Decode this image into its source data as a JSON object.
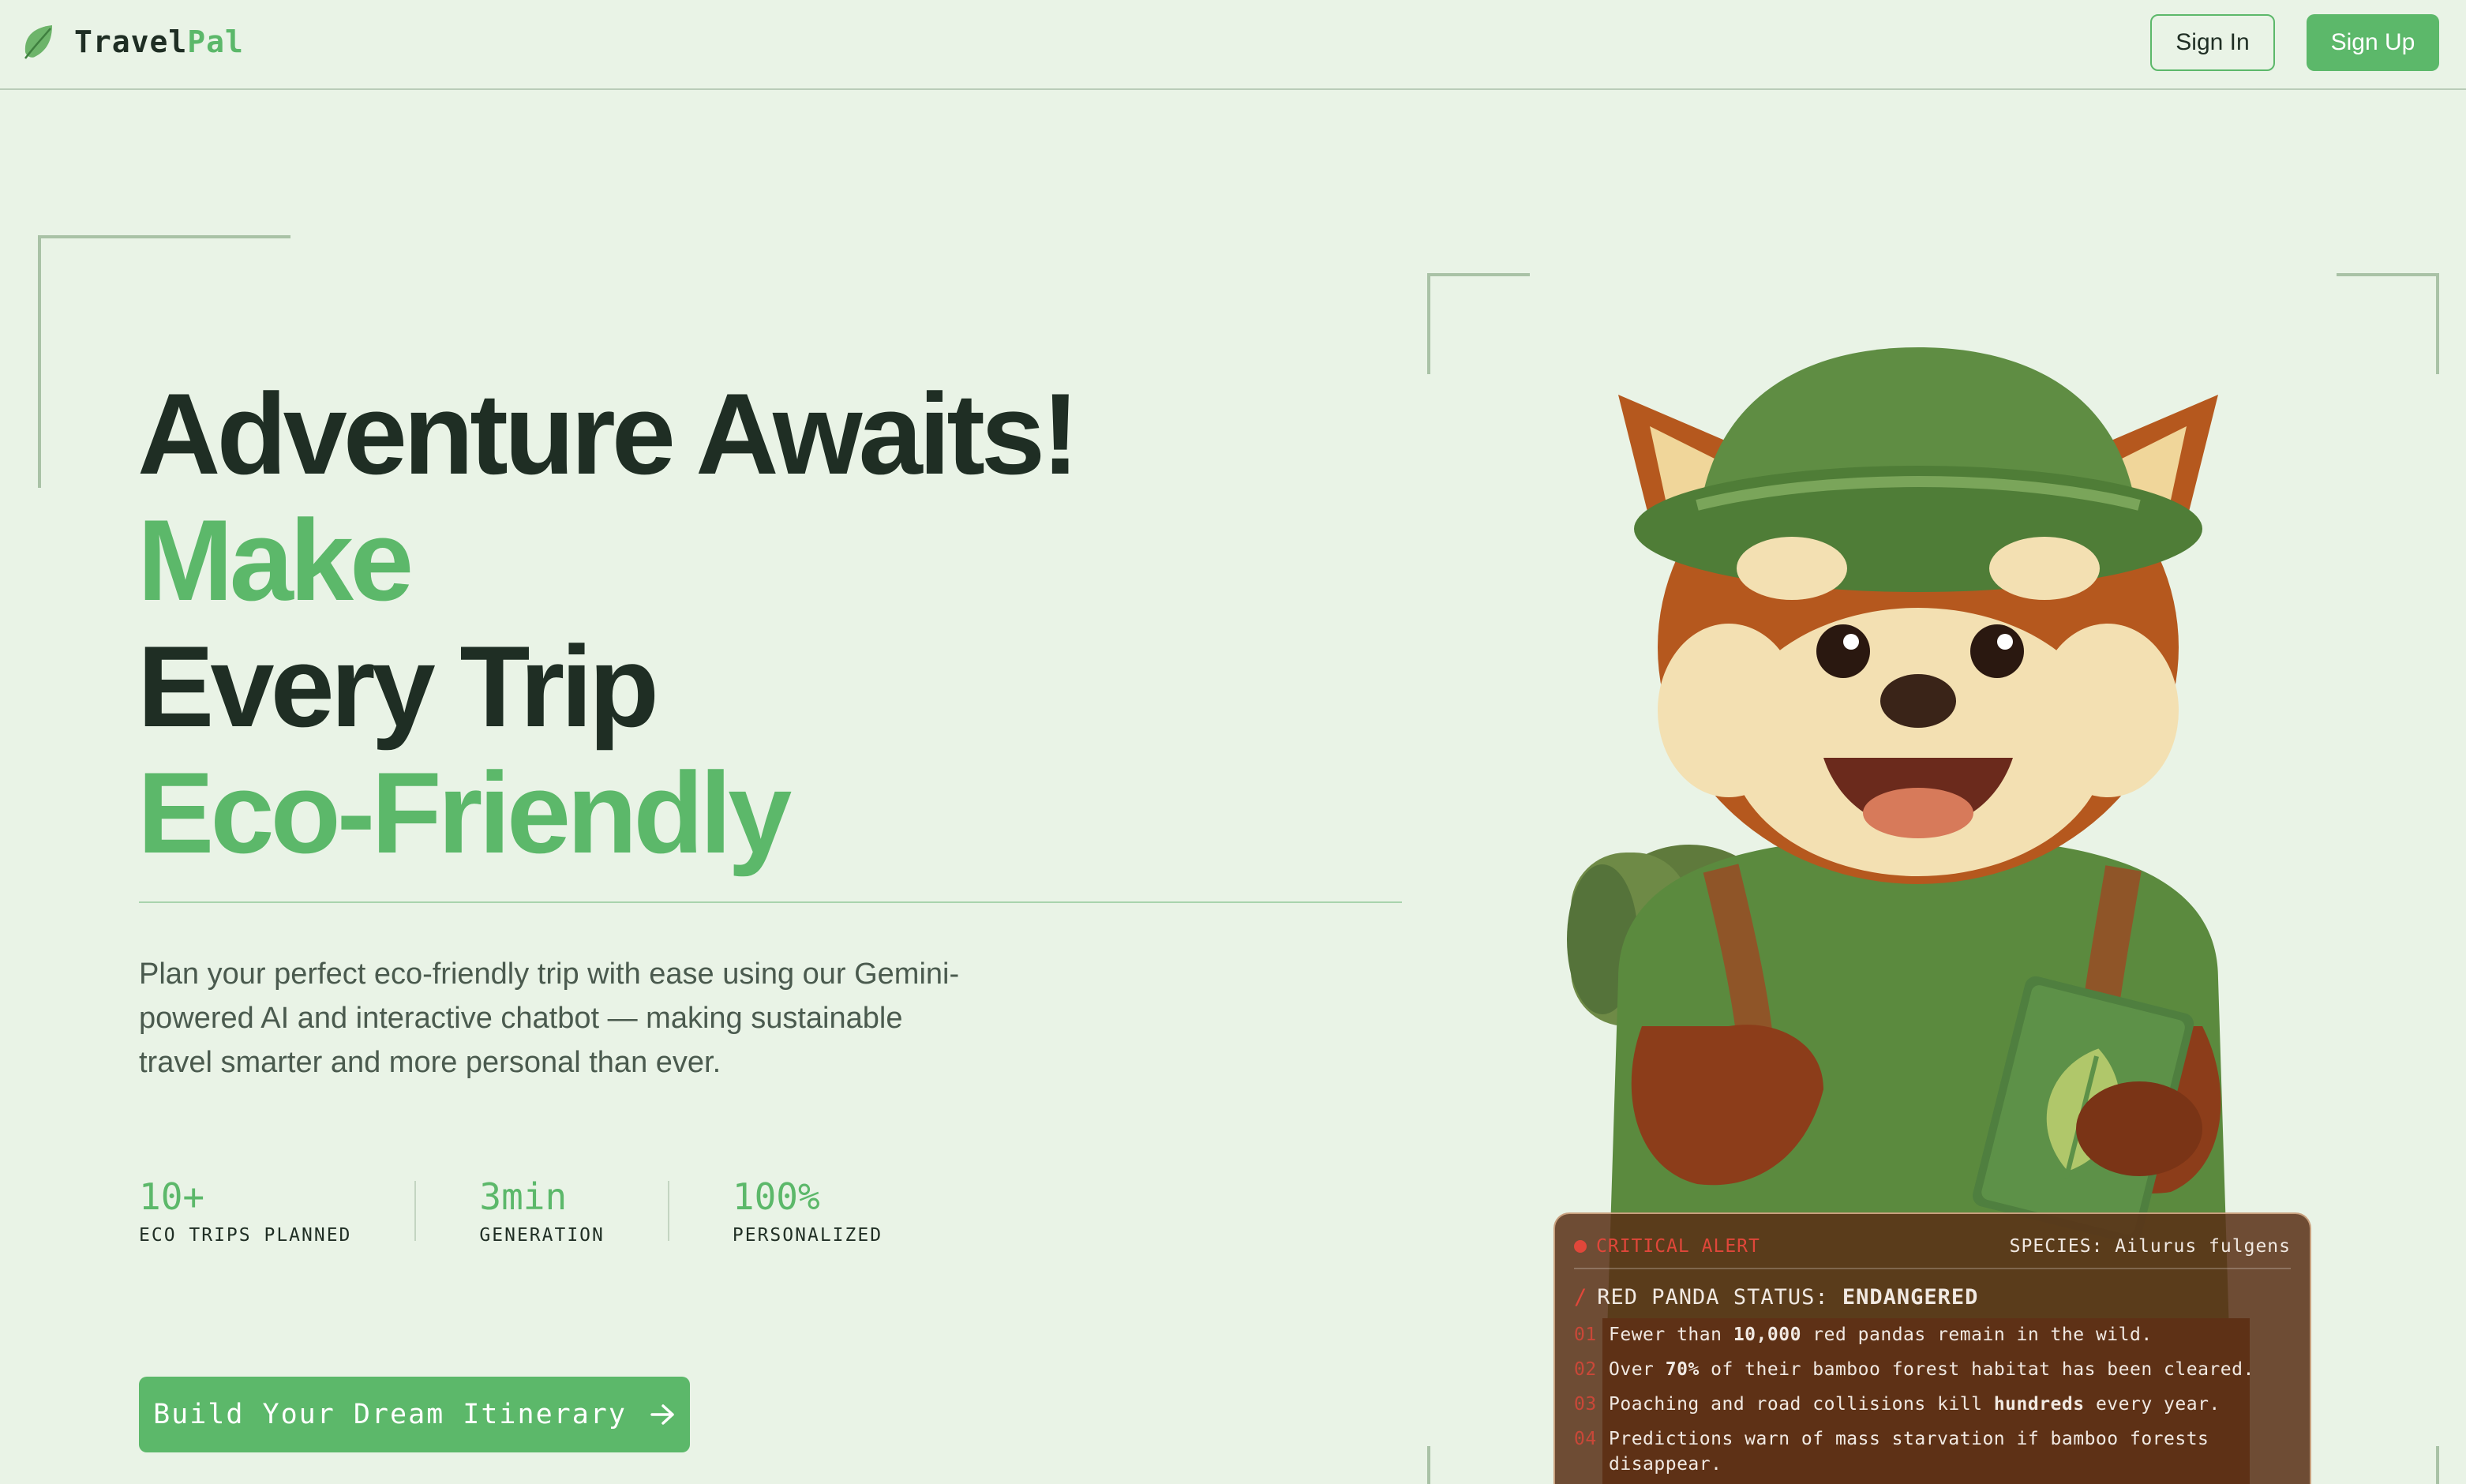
{
  "header": {
    "logo_part1": "Travel",
    "logo_part2": "Pal",
    "logo_icon": "leaf-icon",
    "signin_label": "Sign In",
    "signup_label": "Sign Up"
  },
  "hero": {
    "title_lines": [
      "Adventure Awaits!",
      "Make",
      "Every Trip",
      "Eco-Friendly"
    ],
    "description": "Plan your perfect eco-friendly trip with ease using our Gemini-powered AI and interactive chatbot — making sustainable travel smarter and more personal than ever.",
    "stats": [
      {
        "value": "10+",
        "label": "ECO TRIPS PLANNED"
      },
      {
        "value": "3min",
        "label": "GENERATION"
      },
      {
        "value": "100%",
        "label": "PERSONALIZED"
      }
    ],
    "cta_label": "Build Your Dream Itinerary",
    "cta_icon": "arrow-right-icon"
  },
  "alert": {
    "tag": "CRITICAL ALERT",
    "species": "SPECIES: Ailurus fulgens",
    "status_prefix": "RED PANDA STATUS:",
    "status_value": "ENDANGERED",
    "facts": [
      {
        "num": "01",
        "pre": "Fewer than ",
        "bold": "10,000",
        "post": " red pandas remain in the wild."
      },
      {
        "num": "02",
        "pre": "Over ",
        "bold": "70%",
        "post": " of their bamboo forest habitat has been cleared."
      },
      {
        "num": "03",
        "pre": "Poaching and road collisions kill ",
        "bold": "hundreds",
        "post": " every year."
      },
      {
        "num": "04",
        "pre": "Predictions warn of mass starvation if bamboo forests disappear.",
        "bold": "",
        "post": ""
      }
    ]
  },
  "colors": {
    "background": "#e9f3e6",
    "accent": "#5cb86a",
    "dark_text": "#1f2e24",
    "alert_red": "#e0473a"
  }
}
